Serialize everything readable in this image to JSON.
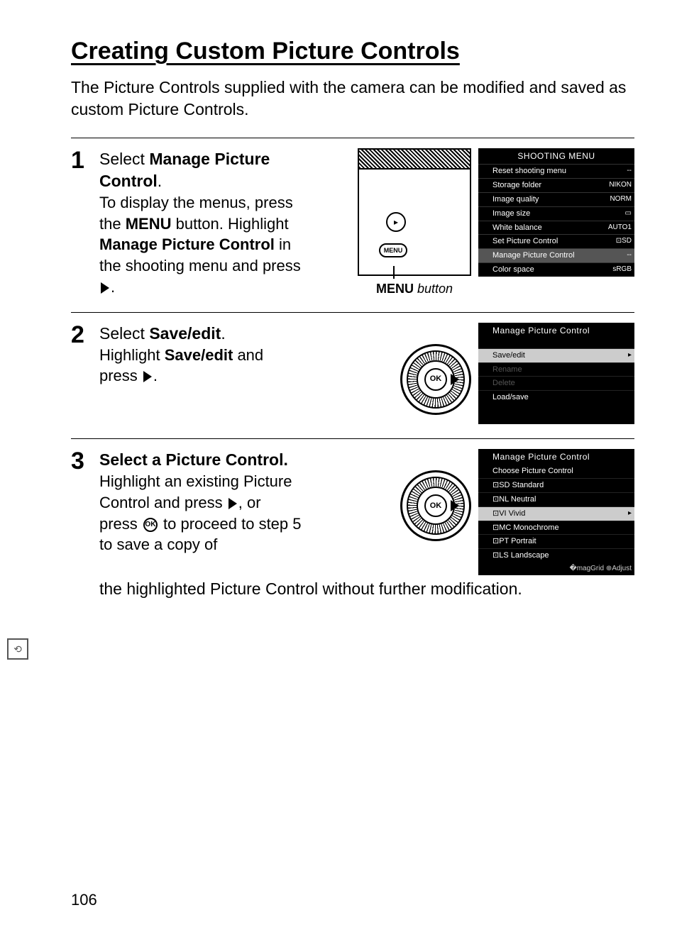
{
  "title": "Creating Custom Picture Controls",
  "intro": "The Picture Controls supplied with the camera can be modified and saved as custom Picture Controls.",
  "page_number": "106",
  "steps": {
    "s1": {
      "num": "1",
      "lead_a": "Select ",
      "lead_b": "Manage Picture Control",
      "lead_c": ".",
      "body_a": "To display the menus, press the ",
      "body_menu": "MENU",
      "body_b": " button. Highlight ",
      "body_bold": "Manage Picture Control",
      "body_c": " in the shooting menu and press ",
      "body_d": ".",
      "caption_a": "MENU",
      "caption_b": " button"
    },
    "s2": {
      "num": "2",
      "lead_a": "Select ",
      "lead_b": "Save/edit",
      "lead_c": ".",
      "body_a": "Highlight ",
      "body_bold": "Save/edit",
      "body_b": " and press ",
      "body_c": "."
    },
    "s3": {
      "num": "3",
      "lead_a": "Select a Picture Control.",
      "body_a": "Highlight an existing Picture Control and press ",
      "body_b": ", or press ",
      "body_c": " to proceed to step 5 to save a copy of",
      "wide": "the highlighted Picture Control without further modification."
    }
  },
  "lcd1": {
    "title": "SHOOTING MENU",
    "rows": [
      {
        "label": "Reset shooting menu",
        "val": "--"
      },
      {
        "label": "Storage folder",
        "val": "NIKON"
      },
      {
        "label": "Image quality",
        "val": "NORM"
      },
      {
        "label": "Image size",
        "val": "▭"
      },
      {
        "label": "White balance",
        "val": "AUTO1"
      },
      {
        "label": "Set Picture Control",
        "val": "⊡SD"
      },
      {
        "label": "Manage Picture Control",
        "val": "--",
        "hi": true
      },
      {
        "label": "Color space",
        "val": "sRGB"
      }
    ]
  },
  "lcd2": {
    "title": "Manage Picture Control",
    "rows": [
      {
        "label": "Save/edit",
        "sel": true,
        "chev": "▸"
      },
      {
        "label": "Rename",
        "disabled": true
      },
      {
        "label": "Delete",
        "disabled": true
      },
      {
        "label": "Load/save"
      }
    ]
  },
  "lcd3": {
    "title": "Manage Picture Control",
    "sub": "Choose Picture Control",
    "rows": [
      {
        "label": "⊡SD Standard"
      },
      {
        "label": "⊡NL Neutral"
      },
      {
        "label": "⊡VI Vivid",
        "sel": true,
        "chev": "▸"
      },
      {
        "label": "⊡MC Monochrome"
      },
      {
        "label": "⊡PT Portrait"
      },
      {
        "label": "⊡LS Landscape"
      }
    ],
    "footer": "�magGrid  ⊕Adjust"
  },
  "ok_label": "OK",
  "menu_btn_label": "MENU",
  "play_icon": "▸"
}
